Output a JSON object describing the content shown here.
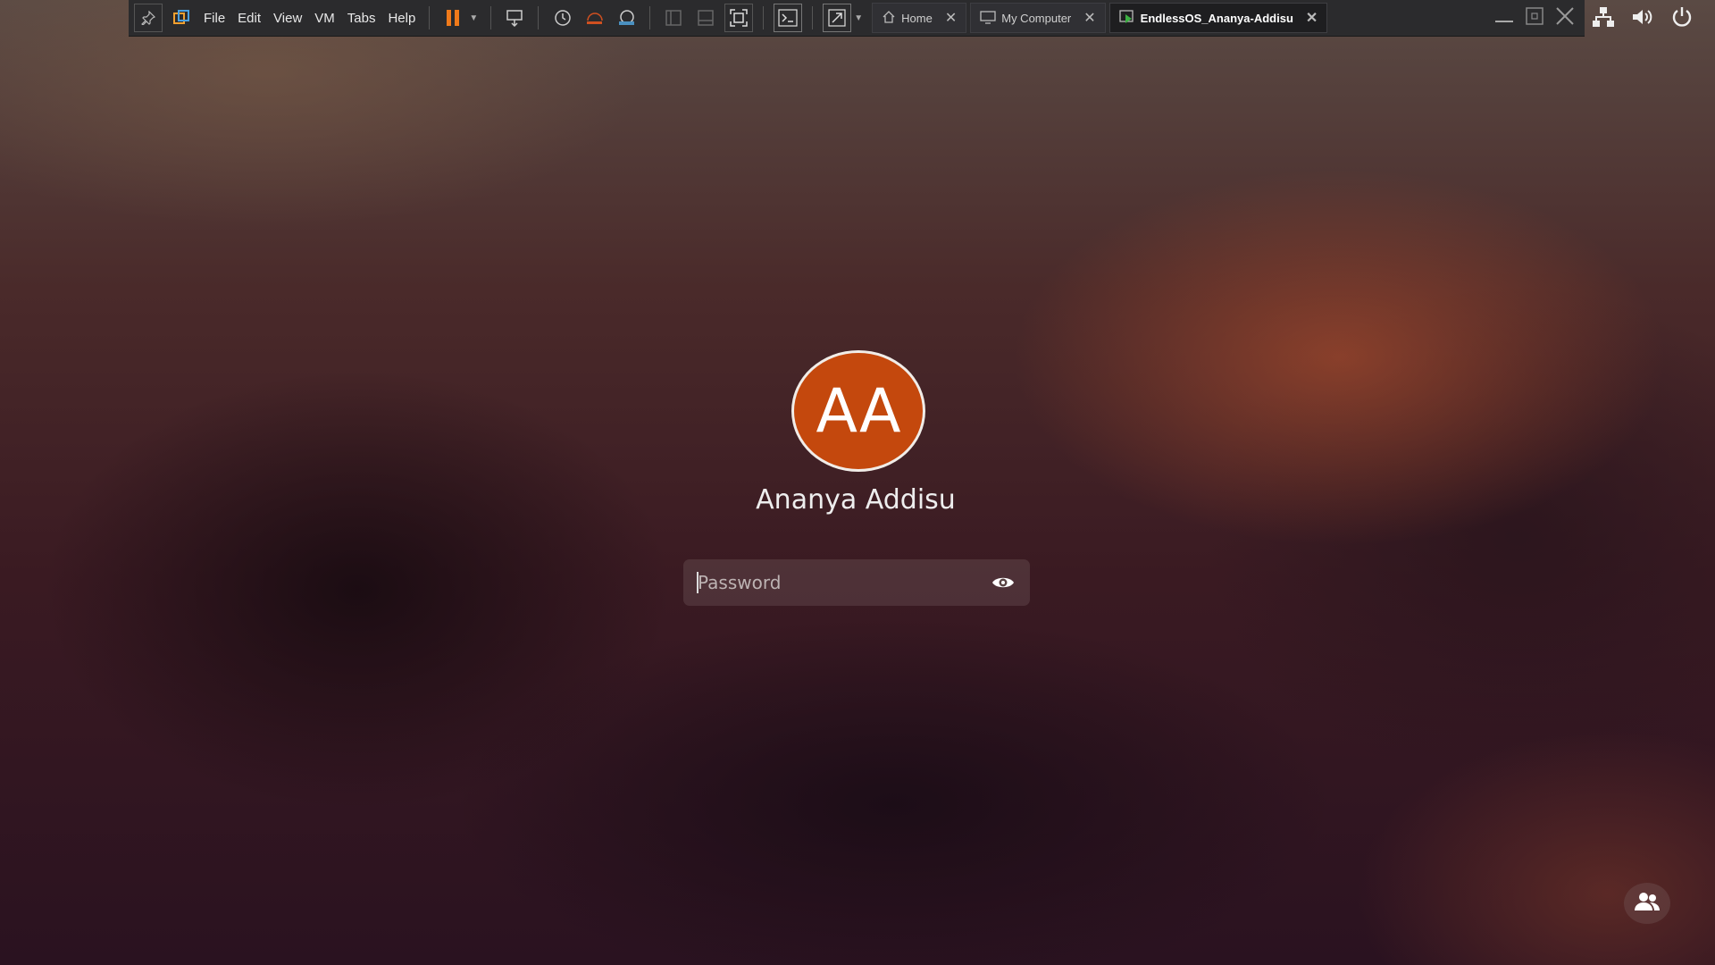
{
  "menu": [
    "File",
    "Edit",
    "View",
    "VM",
    "Tabs",
    "Help"
  ],
  "tabs": [
    {
      "label": "Home"
    },
    {
      "label": "My Computer"
    },
    {
      "label": "EndlessOS_Ananya-Addisu"
    }
  ],
  "login": {
    "initials": "AA",
    "username": "Ananya Addisu",
    "password_placeholder": "Password",
    "avatar_color": "#c4480d"
  },
  "colors": {
    "toolbar": "#2b2b2d",
    "pause_accent": "#f07a1a",
    "vmware_accent": "#f0a030"
  }
}
